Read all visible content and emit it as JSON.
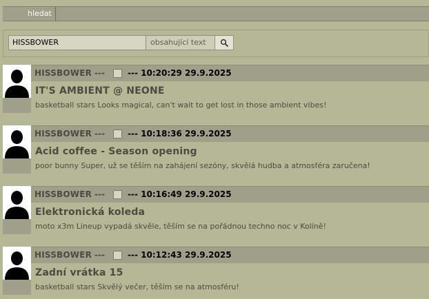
{
  "topbar": {
    "tab_label": "hledat"
  },
  "search": {
    "query": "HISSBOWER",
    "mode": "obsahující text",
    "button_icon": "search-icon"
  },
  "posts": [
    {
      "author": "HISSBOWER",
      "separator": "---",
      "timestamp": "--- 10:20:29 29.9.2025",
      "title": "IT'S AMBIENT @ NEONE",
      "text": "basketball stars Looks magical, can't wait to get lost in those ambient vibes!"
    },
    {
      "author": "HISSBOWER",
      "separator": "---",
      "timestamp": "--- 10:18:36 29.9.2025",
      "title": "Acid coffee - Season opening",
      "text": "poor bunny Super, už se těším na zahájení sezóny, skvělá hudba a atmosféra zaručena!"
    },
    {
      "author": "HISSBOWER",
      "separator": "---",
      "timestamp": "--- 10:16:49 29.9.2025",
      "title": "Elektronická koleda",
      "text": "moto x3m Lineup vypadá skvěle, těším se na pořádnou techno noc v Kolíně!"
    },
    {
      "author": "HISSBOWER",
      "separator": "---",
      "timestamp": "--- 10:12:43 29.9.2025",
      "title": "Zadní vrátka 15",
      "text": "basketball stars Skvělý večer, těším se na atmosféru!"
    }
  ],
  "colors": {
    "background": "#b5b896",
    "header": "#9ea08a",
    "text": "#4a4c40"
  }
}
